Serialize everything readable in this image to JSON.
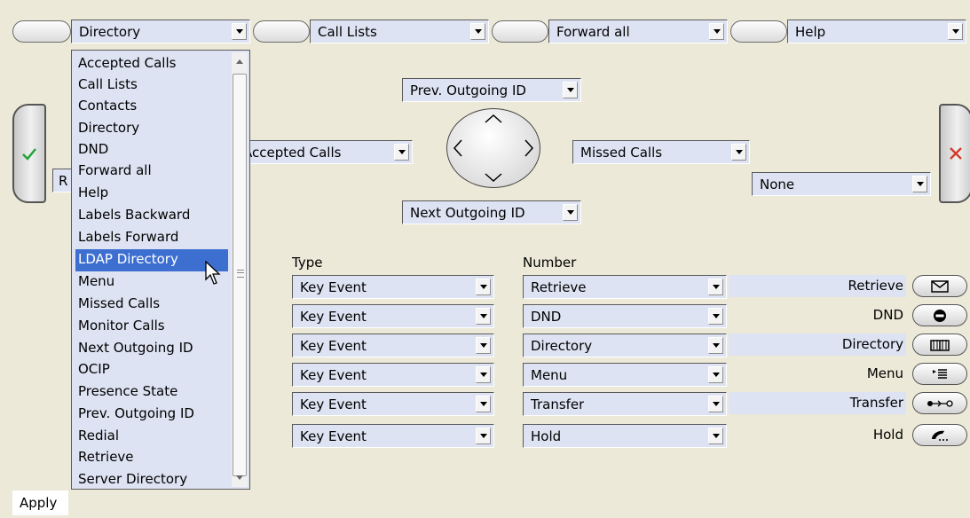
{
  "top_dropdowns": [
    "Directory",
    "Call Lists",
    "Forward all",
    "Help"
  ],
  "open_list": {
    "items": [
      "Accepted Calls",
      "Call Lists",
      "Contacts",
      "Directory",
      "DND",
      "Forward all",
      "Help",
      "Labels Backward",
      "Labels Forward",
      "LDAP Directory",
      "Menu",
      "Missed Calls",
      "Monitor Calls",
      "Next Outgoing ID",
      "OCIP",
      "Presence State",
      "Prev. Outgoing ID",
      "Redial",
      "Retrieve",
      "Server Directory"
    ],
    "highlighted": "LDAP Directory"
  },
  "nav": {
    "up": "Prev. Outgoing ID",
    "down": "Next Outgoing ID",
    "left": "Accepted Calls",
    "right": "Missed Calls",
    "cancel": "None",
    "ok_partial": "R"
  },
  "table": {
    "type_header": "Type",
    "number_header": "Number",
    "rows": [
      {
        "type": "Key Event",
        "number": "Retrieve",
        "label": "Retrieve",
        "icon": "envelope-icon"
      },
      {
        "type": "Key Event",
        "number": "DND",
        "label": "DND",
        "icon": "minus-circle-icon"
      },
      {
        "type": "Key Event",
        "number": "Directory",
        "label": "Directory",
        "icon": "book-icon"
      },
      {
        "type": "Key Event",
        "number": "Menu",
        "label": "Menu",
        "icon": "menu-list-icon"
      },
      {
        "type": "Key Event",
        "number": "Transfer",
        "label": "Transfer",
        "icon": "transfer-icon"
      },
      {
        "type": "Key Event",
        "number": "Hold",
        "label": "Hold",
        "icon": "handset-icon"
      }
    ]
  },
  "apply_label": "Apply",
  "colors": {
    "ok": "#22a33a",
    "cancel": "#d23a2a",
    "highlight": "#3d6fd1",
    "field": "#dde3f2"
  }
}
